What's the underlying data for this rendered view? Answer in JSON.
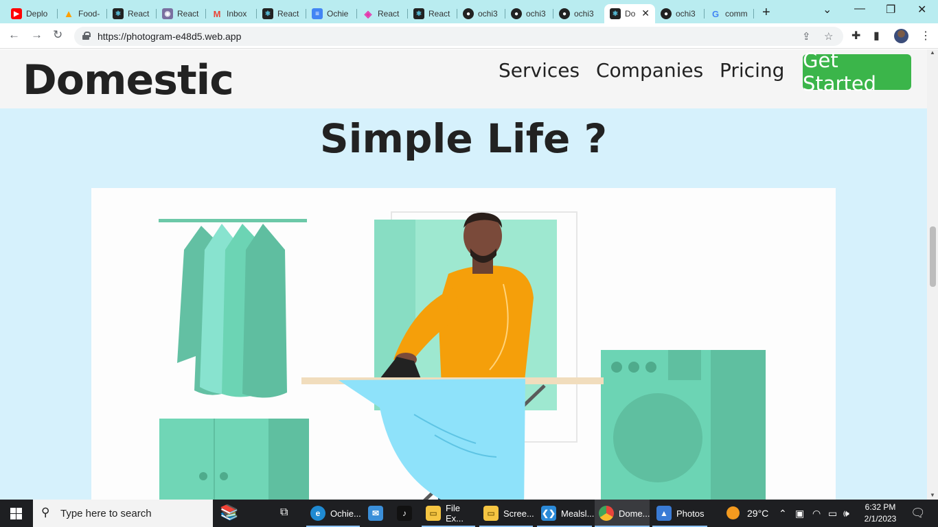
{
  "browser": {
    "tabs": [
      {
        "label": "Deplo",
        "icon": "youtube-icon",
        "color": "#ff0000"
      },
      {
        "label": "Food-",
        "icon": "firebase-icon",
        "color": "#ffa000"
      },
      {
        "label": "React",
        "icon": "react-icon",
        "color": "#61dafb"
      },
      {
        "label": "React",
        "icon": "owl-icon",
        "color": "#7a6fa0"
      },
      {
        "label": "Inbox",
        "icon": "gmail-icon",
        "color": "#ea4335"
      },
      {
        "label": "React",
        "icon": "react-icon",
        "color": "#61dafb"
      },
      {
        "label": "Ochie",
        "icon": "docs-icon",
        "color": "#4285f4"
      },
      {
        "label": "React",
        "icon": "graphql-icon",
        "color": "#e535ab"
      },
      {
        "label": "React",
        "icon": "react-icon",
        "color": "#61dafb"
      },
      {
        "label": "ochi3",
        "icon": "github-icon",
        "color": "#222222"
      },
      {
        "label": "ochi3",
        "icon": "github-icon",
        "color": "#222222"
      },
      {
        "label": "ochi3",
        "icon": "github-icon",
        "color": "#222222"
      },
      {
        "label": "Do",
        "icon": "react-icon",
        "color": "#61dafb",
        "active": true
      },
      {
        "label": "ochi3",
        "icon": "github-icon",
        "color": "#222222"
      },
      {
        "label": "comm",
        "icon": "google-icon",
        "color": "#4285f4"
      }
    ],
    "new_tab_symbol": "+",
    "url": "https://photogram-e48d5.web.app"
  },
  "site": {
    "logo": "Domestic",
    "nav": [
      "Services",
      "Companies",
      "Pricing"
    ],
    "cta": "Get Started",
    "hero_title": "Simple Life ?",
    "colors": {
      "accent": "#3bb54a",
      "background": "#d6f1fc",
      "nav_bg": "#f5f5f5",
      "teal": "#6cd4b4",
      "shirt": "#f59f0a",
      "cloth": "#8ee2fa"
    }
  },
  "taskbar": {
    "search_placeholder": "Type here to search",
    "apps": [
      {
        "label": "Ochie...",
        "icon": "edge-icon",
        "color": "#1f8ad2"
      },
      {
        "label": "",
        "icon": "mail-icon",
        "color": "#3b8fd9"
      },
      {
        "label": "",
        "icon": "tiktok-icon",
        "color": "#111111"
      },
      {
        "label": "File Ex...",
        "icon": "folder-icon",
        "color": "#f5c542"
      },
      {
        "label": "Scree...",
        "icon": "folder-icon",
        "color": "#f5c542"
      },
      {
        "label": "Mealsl...",
        "icon": "vscode-icon",
        "color": "#2b8ad8"
      },
      {
        "label": "Dome...",
        "icon": "chrome-icon",
        "color": "#e8453c",
        "active": true
      },
      {
        "label": "Photos",
        "icon": "photos-icon",
        "color": "#3a7bd5"
      }
    ],
    "weather": "29°C",
    "time": "6:32 PM",
    "date": "2/1/2023"
  }
}
